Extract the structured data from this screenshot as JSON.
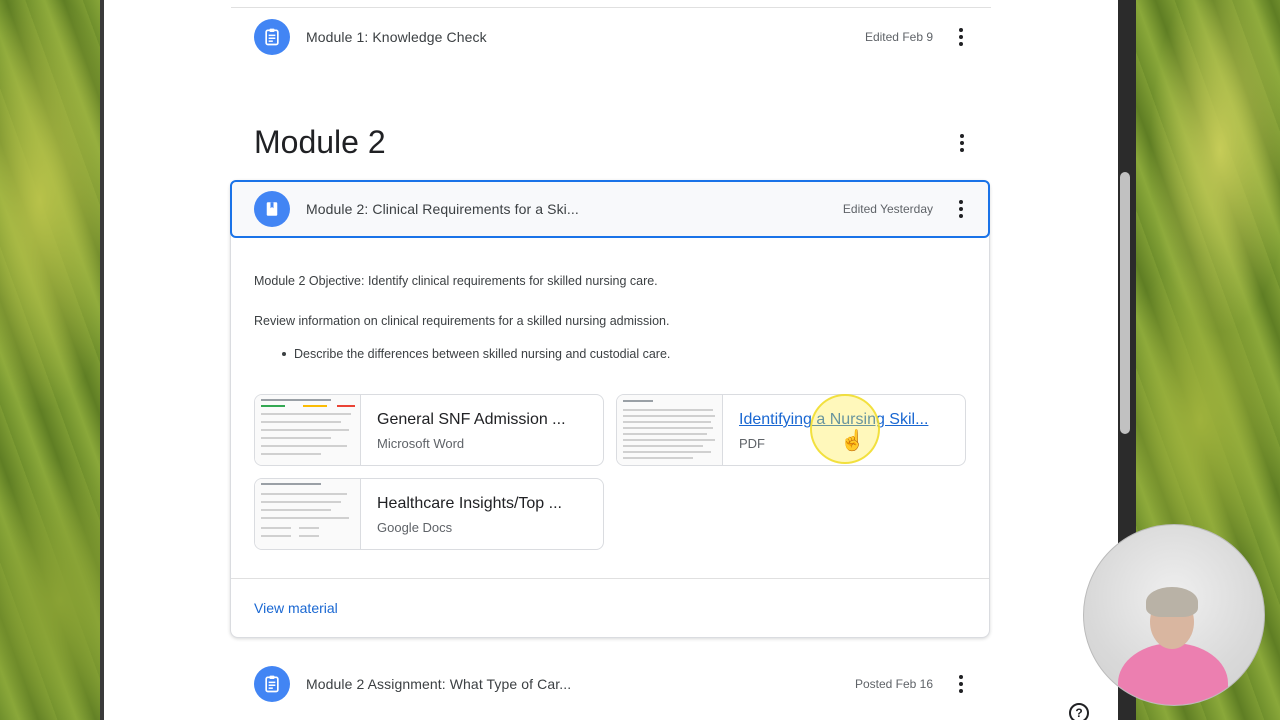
{
  "top_item": {
    "title": "Module 1: Knowledge Check",
    "meta": "Edited Feb 9"
  },
  "module": {
    "title": "Module 2"
  },
  "material": {
    "title": "Module 2: Clinical Requirements for a Ski...",
    "meta": "Edited Yesterday",
    "objective": "Module 2 Objective:  Identify clinical requirements for skilled nursing care.",
    "review": "Review information on clinical requirements for a skilled nursing admission.",
    "bullet": "Describe the differences between skilled nursing and custodial care.",
    "attachments": [
      {
        "title": "General SNF Admission ...",
        "type": "Microsoft Word"
      },
      {
        "title": "Identifying a Nursing Skil...",
        "type": "PDF"
      },
      {
        "title": "Healthcare Insights/Top ...",
        "type": "Google Docs"
      }
    ],
    "view_label": "View material"
  },
  "bottom_item": {
    "title": "Module 2 Assignment: What Type of Car...",
    "meta": "Posted Feb 16"
  },
  "help_label": "?",
  "colors": {
    "accent": "#4285f4",
    "link": "#1967d2",
    "selected_border": "#1a73e8"
  },
  "icons": [
    "assignment-icon",
    "material-book-icon",
    "more-vert-icon",
    "help-icon",
    "hand-cursor-icon"
  ]
}
